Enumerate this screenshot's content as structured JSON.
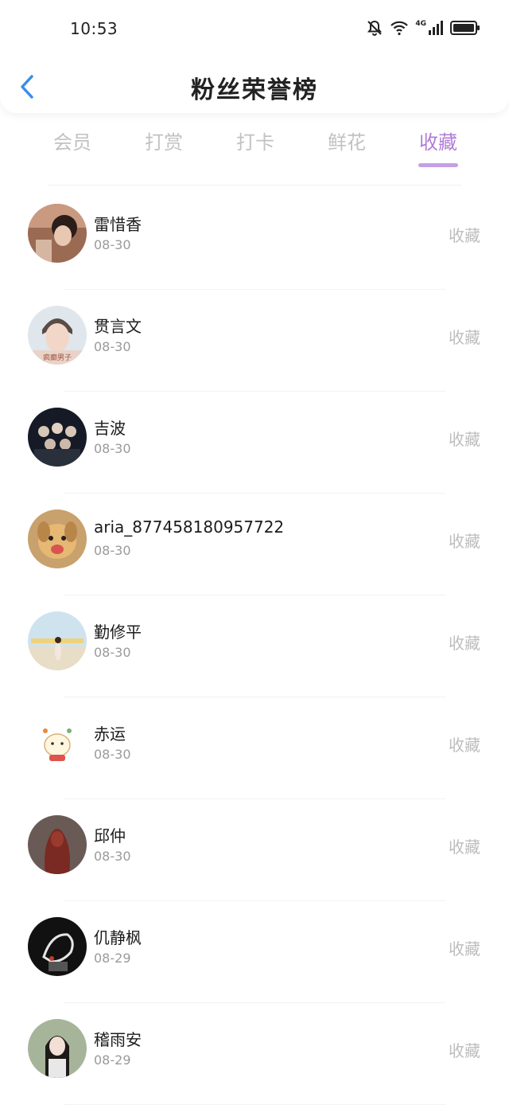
{
  "status_bar": {
    "time": "10:53",
    "network": "4G"
  },
  "header": {
    "title": "粉丝荣誉榜"
  },
  "tabs": [
    {
      "label": "会员"
    },
    {
      "label": "打赏"
    },
    {
      "label": "打卡"
    },
    {
      "label": "鲜花"
    },
    {
      "label": "收藏"
    }
  ],
  "active_tab": "收藏",
  "colors": {
    "accent": "#b07cd8",
    "underline": "#c4a0e4",
    "muted": "#c2c2c2"
  },
  "fans": [
    {
      "name": "雷惜香",
      "date": "08-30",
      "action": "收藏",
      "avatar_icon": "photo-avatar"
    },
    {
      "name": "贯言文",
      "date": "08-30",
      "action": "收藏",
      "avatar_icon": "photo-avatar",
      "avatar_caption": "疯癫男子"
    },
    {
      "name": "吉波",
      "date": "08-30",
      "action": "收藏",
      "avatar_icon": "photo-avatar"
    },
    {
      "name": "aria_877458180957722",
      "date": "08-30",
      "action": "收藏",
      "avatar_icon": "dog-avatar"
    },
    {
      "name": "勤修平",
      "date": "08-30",
      "action": "收藏",
      "avatar_icon": "photo-avatar"
    },
    {
      "name": "赤运",
      "date": "08-30",
      "action": "收藏",
      "avatar_icon": "cartoon-avatar"
    },
    {
      "name": "邱仲",
      "date": "08-30",
      "action": "收藏",
      "avatar_icon": "statue-avatar"
    },
    {
      "name": "仉静枫",
      "date": "08-29",
      "action": "收藏",
      "avatar_icon": "photo-avatar"
    },
    {
      "name": "稽雨安",
      "date": "08-29",
      "action": "收藏",
      "avatar_icon": "photo-avatar"
    }
  ]
}
